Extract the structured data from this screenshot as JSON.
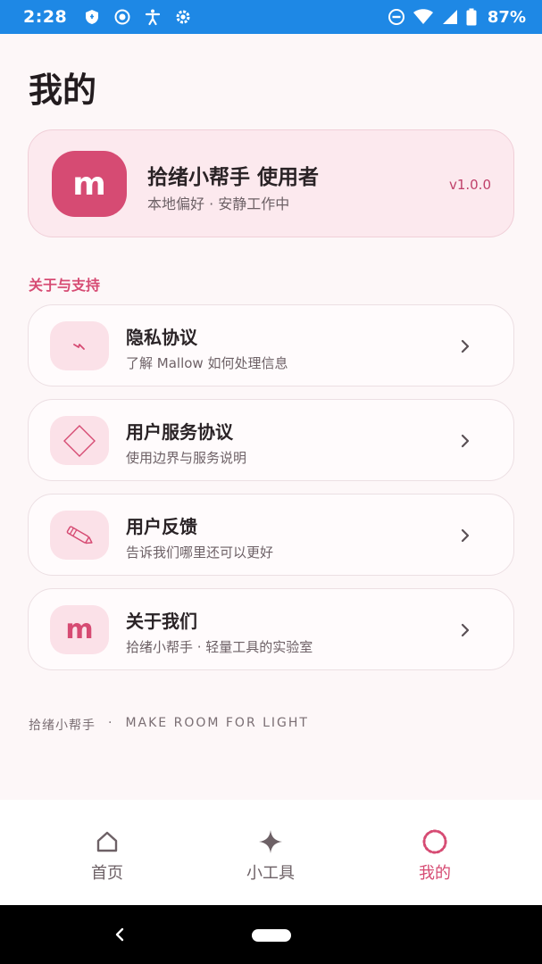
{
  "status_bar": {
    "time": "2:28",
    "battery": "87%",
    "icons": [
      "shield-icon",
      "record-icon",
      "accessibility-icon",
      "settings-icon",
      "dnd-icon",
      "wifi-icon",
      "signal-icon",
      "battery-icon"
    ]
  },
  "page": {
    "title": "我的"
  },
  "profile": {
    "avatar_letter": "m",
    "name": "拾绪小帮手 使用者",
    "subtitle": "本地偏好 · 安静工作中",
    "version": "v1.0.0"
  },
  "section": {
    "title": "关于与支持"
  },
  "menu": [
    {
      "title": "隐私协议",
      "subtitle": "了解 Mallow 如何处理信息",
      "icon": "lightning-icon"
    },
    {
      "title": "用户服务协议",
      "subtitle": "使用边界与服务说明",
      "icon": "diamond-icon"
    },
    {
      "title": "用户反馈",
      "subtitle": "告诉我们哪里还可以更好",
      "icon": "pencil-icon"
    },
    {
      "title": "关于我们",
      "subtitle": "拾绪小帮手 · 轻量工具的实验室",
      "icon": "m-letter-icon",
      "icon_letter": "m"
    }
  ],
  "footer": {
    "brand": "拾绪小帮手",
    "separator": "·",
    "slogan": "MAKE ROOM FOR LIGHT"
  },
  "bottom_nav": [
    {
      "label": "首页",
      "icon": "home-icon",
      "active": false
    },
    {
      "label": "小工具",
      "icon": "sparkle-icon",
      "active": false
    },
    {
      "label": "我的",
      "icon": "profile-ring-icon",
      "active": true
    }
  ],
  "colors": {
    "accent": "#d64b73",
    "status_bar": "#1e88e5",
    "background": "#fdf7f8",
    "card_tint": "#fce9ee"
  }
}
